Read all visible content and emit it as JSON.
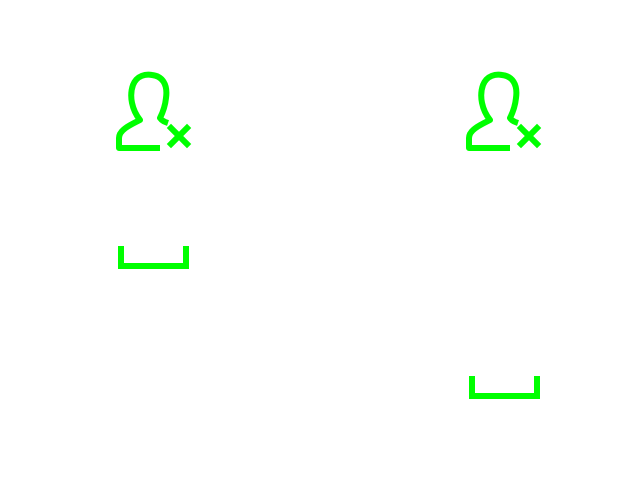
{
  "colors": {
    "accent": "#00ff00",
    "background": "#ffffff"
  },
  "icons": [
    {
      "name": "user-remove-icon"
    },
    {
      "name": "user-remove-icon"
    },
    {
      "name": "space-bracket-icon"
    },
    {
      "name": "space-bracket-icon"
    }
  ]
}
